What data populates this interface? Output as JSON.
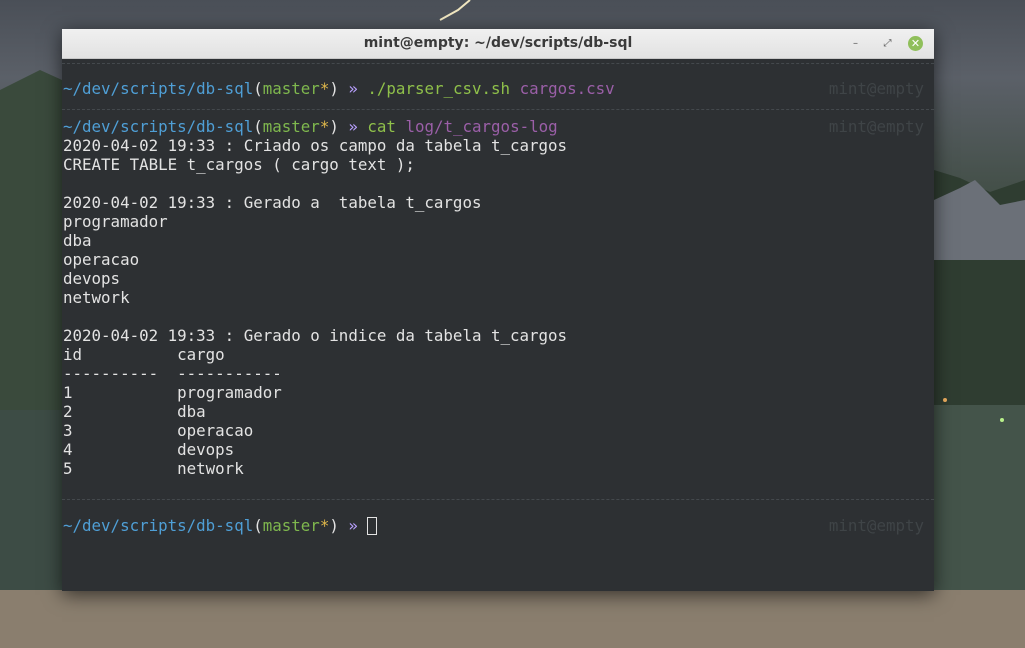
{
  "window": {
    "title": "mint@empty: ~/dev/scripts/db-sql",
    "minimize_icon": "minimize-icon",
    "maximize_icon": "maximize-icon",
    "close_icon": "close-icon",
    "close_color": "#8fbf5a"
  },
  "prompts": [
    {
      "path": "~/dev/scripts/db-sql",
      "open": "(",
      "branch": "master",
      "dirty": "*",
      "close": ")",
      "arrow": "»",
      "command": "./parser_csv.sh",
      "args": "cargos.csv",
      "host": "mint@empty"
    },
    {
      "path": "~/dev/scripts/db-sql",
      "open": "(",
      "branch": "master",
      "dirty": "*",
      "close": ")",
      "arrow": "»",
      "command": "cat",
      "args": "log/t_cargos-log",
      "host": "mint@empty"
    },
    {
      "path": "~/dev/scripts/db-sql",
      "open": "(",
      "branch": "master",
      "dirty": "*",
      "close": ")",
      "arrow": "»",
      "command": "",
      "args": "",
      "host": "mint@empty"
    }
  ],
  "output": [
    "2020-04-02 19:33 : Criado os campo da tabela t_cargos",
    "CREATE TABLE t_cargos ( cargo text );",
    "",
    "2020-04-02 19:33 : Gerado a  tabela t_cargos",
    "programador",
    "dba",
    "operacao",
    "devops",
    "network",
    "",
    "2020-04-02 19:33 : Gerado o indice da tabela t_cargos",
    "id          cargo",
    "----------  -----------",
    "1           programador",
    "2           dba",
    "3           operacao",
    "4           devops",
    "5           network"
  ],
  "colors": {
    "terminal_bg": "#2d3033",
    "path": "#4f9fd6",
    "branch": "#7fb84e",
    "command": "#8fc04a",
    "argument": "#9b5fa8",
    "text": "#e3e3e3"
  }
}
